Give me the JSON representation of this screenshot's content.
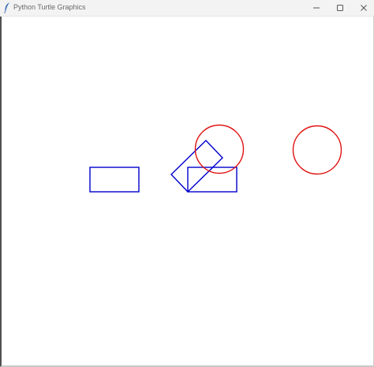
{
  "window": {
    "title": "Python Turtle Graphics",
    "app_icon": "feather-icon",
    "controls": [
      "minimize-icon",
      "maximize-icon",
      "close-icon"
    ]
  },
  "canvas": {
    "background": "#ffffff",
    "rectangle_color": "#0000cc",
    "circle_color": "#e01010",
    "shapes": [
      {
        "type": "rectangle",
        "color": "blue"
      },
      {
        "type": "rotated-rectangle",
        "color": "blue"
      },
      {
        "type": "rectangle",
        "color": "blue"
      },
      {
        "type": "circle",
        "color": "red"
      },
      {
        "type": "circle",
        "color": "red"
      }
    ]
  }
}
